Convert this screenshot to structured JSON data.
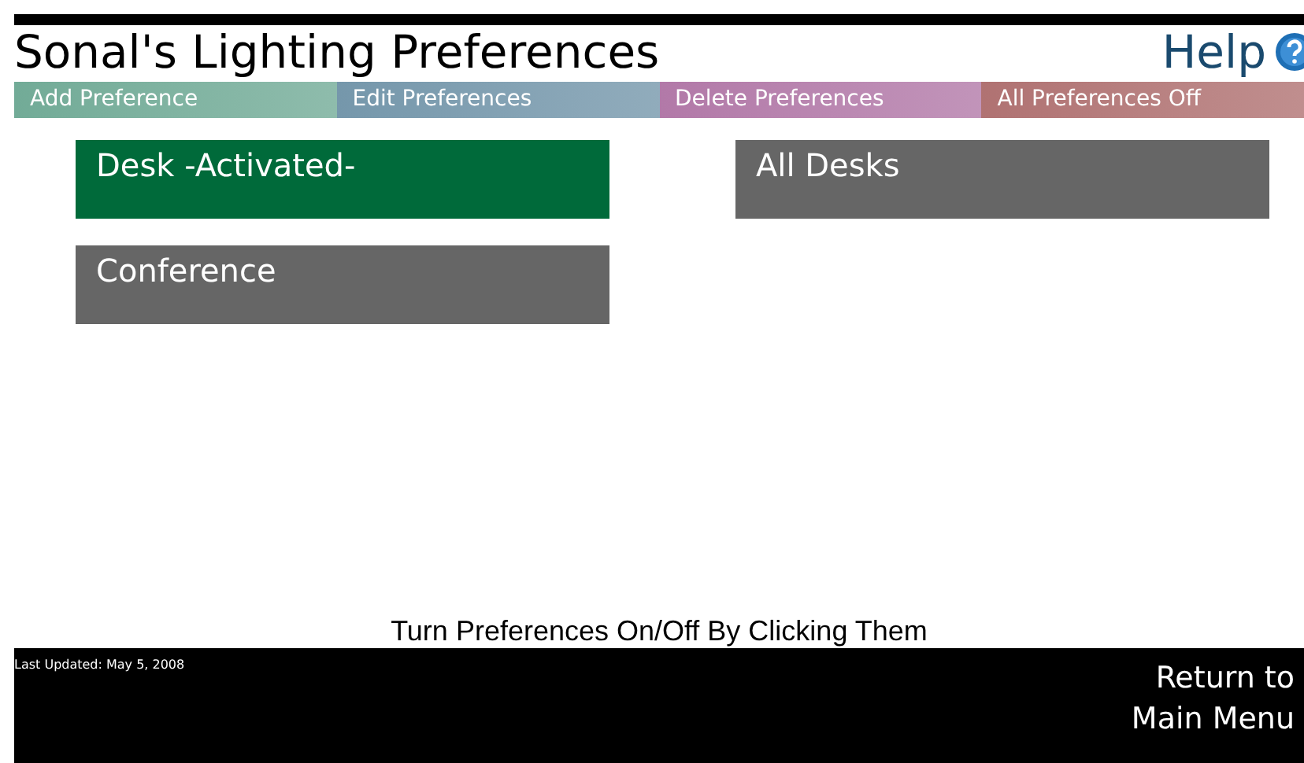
{
  "header": {
    "title": "Sonal's Lighting Preferences",
    "help": "Help"
  },
  "menu": [
    {
      "label": "Add Preference",
      "color": "#72ab97"
    },
    {
      "label": "Edit Preferences",
      "color": "#7597ab"
    },
    {
      "label": "Delete Preferences",
      "color": "#b279a8"
    },
    {
      "label": "All Preferences Off",
      "color": "#b07272"
    }
  ],
  "preferences": [
    {
      "label": "Desk -Activated-",
      "activated": true
    },
    {
      "label": "All Desks",
      "activated": false
    },
    {
      "label": "Conference",
      "activated": false
    }
  ],
  "instruction": "Turn Preferences On/Off By Clicking Them",
  "footer": {
    "updated": "Last Updated: May 5, 2008",
    "return_line_1": "Return to",
    "return_line_2": "Main Menu"
  }
}
